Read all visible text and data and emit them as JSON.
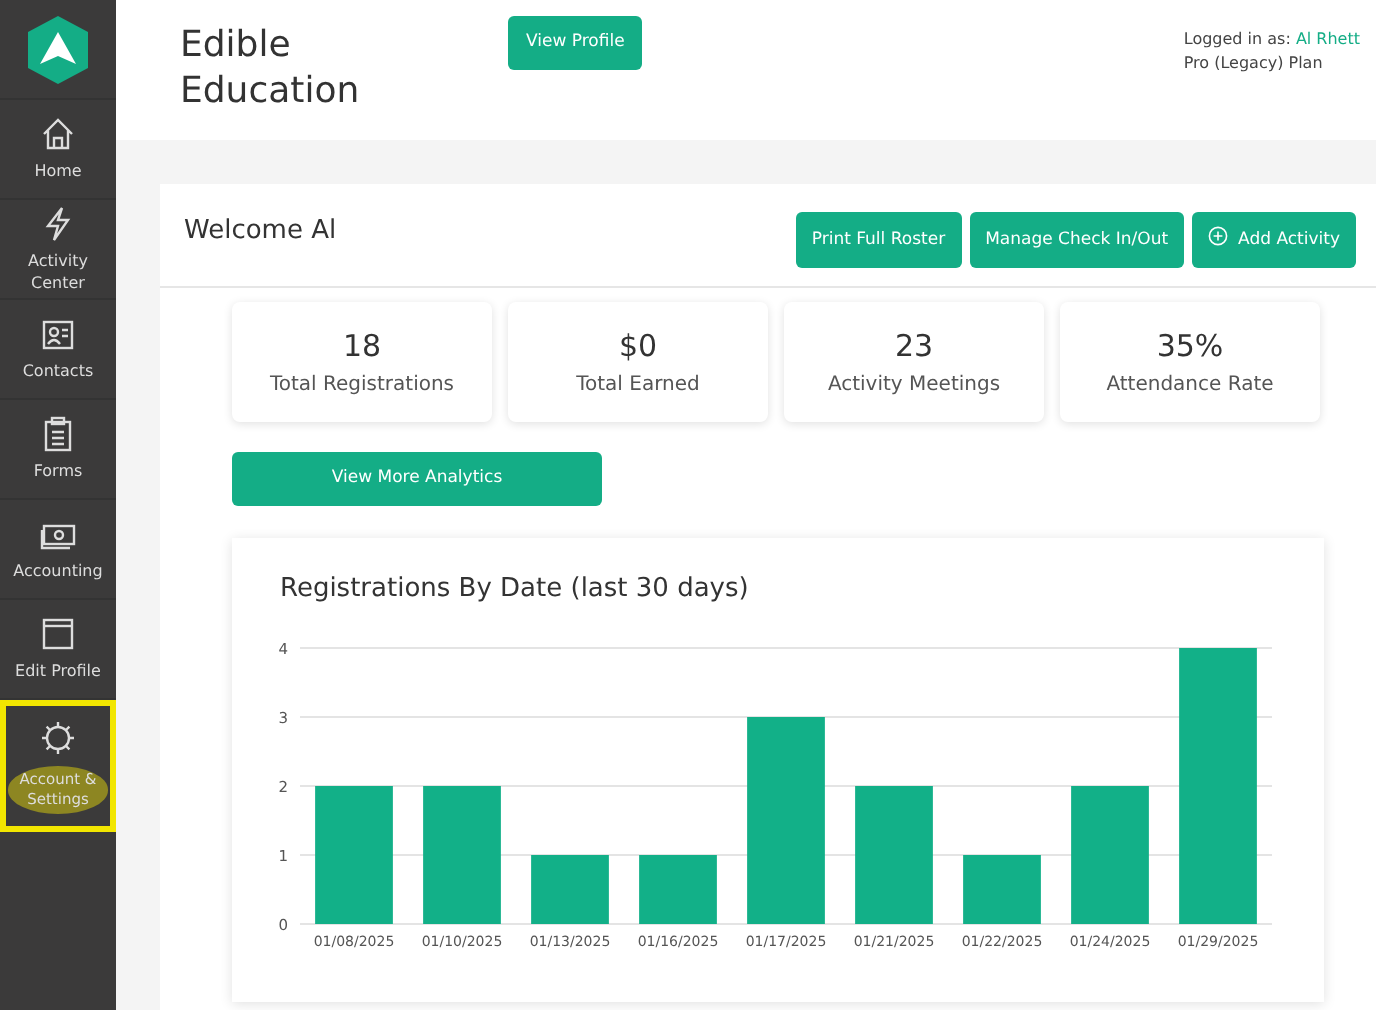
{
  "sidebar": {
    "items": [
      {
        "label": "Home",
        "highlighted": false
      },
      {
        "label": "Activity Center",
        "highlighted": false
      },
      {
        "label": "Contacts",
        "highlighted": false
      },
      {
        "label": "Forms",
        "highlighted": false
      },
      {
        "label": "Accounting",
        "highlighted": false
      },
      {
        "label": "Edit Profile",
        "highlighted": false
      },
      {
        "label": "Account & Settings",
        "highlighted": true
      }
    ]
  },
  "header": {
    "title": "Edible Education",
    "profile_button": "View Profile",
    "logged_in_label": "Logged in as:",
    "user_name": "Al Rhett",
    "plan": "Pro (Legacy) Plan"
  },
  "welcome": {
    "title": "Welcome Al",
    "buttons": [
      {
        "label": "Print Full Roster",
        "kind": "plain"
      },
      {
        "label": "Manage Check In/Out",
        "kind": "plain"
      },
      {
        "label": "Add Activity",
        "kind": "add"
      }
    ]
  },
  "stats": [
    {
      "value": "18",
      "label": "Total Registrations"
    },
    {
      "value": "$0",
      "label": "Total Earned"
    },
    {
      "value": "23",
      "label": "Activity Meetings"
    },
    {
      "value": "35%",
      "label": "Attendance Rate"
    }
  ],
  "analytics_button": "View More Analytics",
  "chart": {
    "title": "Registrations By Date (last 30 days)",
    "chart_data": {
      "type": "bar",
      "categories": [
        "01/08/2025",
        "01/10/2025",
        "01/13/2025",
        "01/16/2025",
        "01/17/2025",
        "01/21/2025",
        "01/22/2025",
        "01/24/2025",
        "01/29/2025"
      ],
      "series": [
        {
          "color": "#12b088",
          "values": [
            2,
            2,
            1,
            1,
            3,
            2,
            1,
            2,
            4
          ]
        }
      ],
      "ylim": [
        0,
        4
      ],
      "yticks": [
        0,
        1,
        2,
        3,
        4
      ],
      "grid": true
    }
  }
}
